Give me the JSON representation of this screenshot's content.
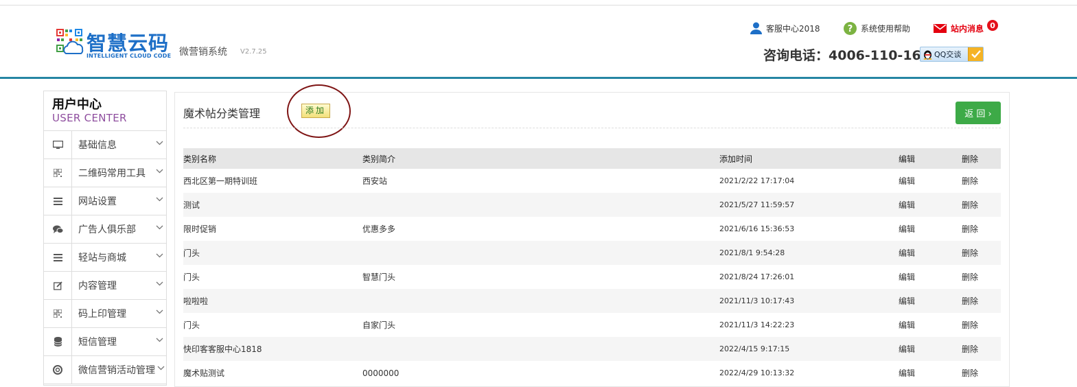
{
  "header": {
    "logo_title": "智慧云码",
    "logo_subtitle": "INTELLIGENT CLOUD CODE",
    "system_name": "微营销系统",
    "version": "V2.7.25",
    "service_center": "客服中心2018",
    "help": "系统使用帮助",
    "messages": "站内消息",
    "message_count": "0",
    "phone": "咨询电话：4006-110-166",
    "qq_label": "QQ交谈"
  },
  "sidebar": {
    "title": "用户中心",
    "subtitle": "USER CENTER",
    "items": [
      {
        "label": "基础信息",
        "icon": "monitor-icon"
      },
      {
        "label": "二维码常用工具",
        "icon": "qrcode-icon"
      },
      {
        "label": "网站设置",
        "icon": "list-icon"
      },
      {
        "label": "广告人俱乐部",
        "icon": "chat-icon"
      },
      {
        "label": "轻站与商城",
        "icon": "list-icon"
      },
      {
        "label": "内容管理",
        "icon": "edit-icon"
      },
      {
        "label": "码上印管理",
        "icon": "qrcode-icon"
      },
      {
        "label": "短信管理",
        "icon": "database-icon"
      },
      {
        "label": "微信营销活动管理",
        "icon": "lifebuoy-icon"
      }
    ]
  },
  "panel": {
    "title": "魔术帖分类管理",
    "add_label": "添加",
    "back_label": "返 回 ›"
  },
  "table": {
    "headers": [
      "类别名称",
      "类别简介",
      "添加时间",
      "编辑",
      "删除"
    ],
    "rows": [
      {
        "name": "西北区第一期特训班",
        "desc": "西安站",
        "time": "2021/2/22 17:17:04",
        "edit": "编辑",
        "del": "删除"
      },
      {
        "name": "测试",
        "desc": "",
        "time": "2021/5/27 11:59:57",
        "edit": "编辑",
        "del": "删除"
      },
      {
        "name": "限时促销",
        "desc": "优惠多多",
        "time": "2021/6/16 15:36:53",
        "edit": "编辑",
        "del": "删除"
      },
      {
        "name": "门头",
        "desc": "",
        "time": "2021/8/1 9:54:28",
        "edit": "编辑",
        "del": "删除"
      },
      {
        "name": "门头",
        "desc": "智慧门头",
        "time": "2021/8/24 17:26:01",
        "edit": "编辑",
        "del": "删除"
      },
      {
        "name": "啦啦啦",
        "desc": "",
        "time": "2021/11/3 10:17:43",
        "edit": "编辑",
        "del": "删除"
      },
      {
        "name": "门头",
        "desc": "自家门头",
        "time": "2021/11/3 14:22:23",
        "edit": "编辑",
        "del": "删除"
      },
      {
        "name": "快印客客服中心1818",
        "desc": "",
        "time": "2022/4/15 9:17:15",
        "edit": "编辑",
        "del": "删除"
      },
      {
        "name": "魔术贴测试",
        "desc": "0000000",
        "time": "2022/4/29 10:13:32",
        "edit": "编辑",
        "del": "删除"
      }
    ]
  },
  "colors": {
    "brand_blue": "#1d6fc7",
    "header_border": "#2586a3",
    "back_button": "#3daa47",
    "message_red": "#e4000f",
    "circle_annotation": "#7e1414"
  }
}
